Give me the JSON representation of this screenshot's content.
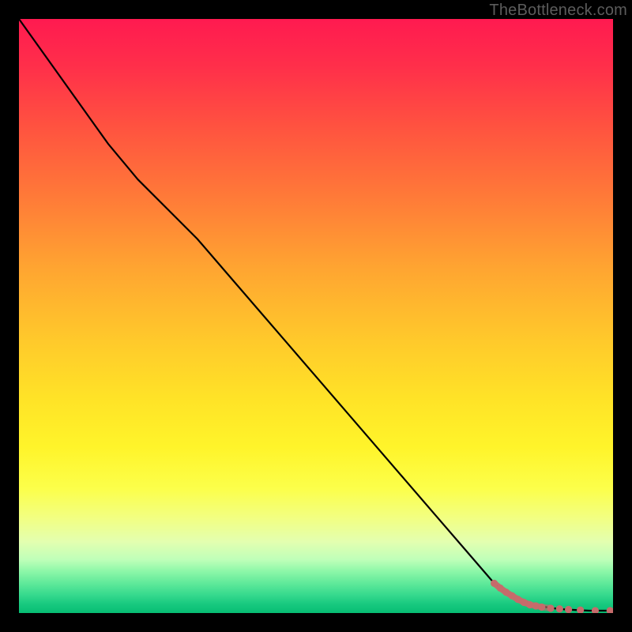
{
  "watermark": "TheBottleneck.com",
  "chart_data": {
    "type": "line",
    "title": "",
    "xlabel": "",
    "ylabel": "",
    "xlim": [
      0,
      100
    ],
    "ylim": [
      0,
      100
    ],
    "grid": false,
    "series": [
      {
        "name": "bottleneck-curve",
        "stroke": "#000000",
        "x": [
          0,
          5,
          10,
          15,
          20,
          25,
          30,
          35,
          40,
          45,
          50,
          55,
          60,
          65,
          70,
          75,
          80,
          82,
          84,
          86,
          88,
          90,
          92,
          94,
          96,
          98,
          100
        ],
        "y": [
          100,
          93,
          86,
          79,
          73,
          68,
          63,
          57.2,
          51.4,
          45.6,
          39.8,
          34.0,
          28.2,
          22.4,
          16.6,
          10.8,
          5.0,
          3.4,
          2.3,
          1.6,
          1.1,
          0.8,
          0.6,
          0.5,
          0.4,
          0.4,
          0.4
        ]
      }
    ],
    "tail_markers": {
      "name": "curve-tail-dots",
      "fill": "#c66b6b",
      "points": [
        {
          "x": 80.0,
          "y": 5.0
        },
        {
          "x": 81.0,
          "y": 4.2
        },
        {
          "x": 82.0,
          "y": 3.5
        },
        {
          "x": 83.0,
          "y": 2.9
        },
        {
          "x": 84.0,
          "y": 2.3
        },
        {
          "x": 85.0,
          "y": 1.8
        },
        {
          "x": 86.0,
          "y": 1.4
        },
        {
          "x": 87.0,
          "y": 1.2
        },
        {
          "x": 88.0,
          "y": 1.0
        },
        {
          "x": 89.5,
          "y": 0.8
        },
        {
          "x": 91.0,
          "y": 0.7
        },
        {
          "x": 92.5,
          "y": 0.6
        },
        {
          "x": 94.5,
          "y": 0.5
        },
        {
          "x": 97.0,
          "y": 0.4
        },
        {
          "x": 99.5,
          "y": 0.4
        }
      ]
    },
    "gradient_stops": [
      {
        "pos": 0,
        "color": "#ff1a50"
      },
      {
        "pos": 30,
        "color": "#ff7a38"
      },
      {
        "pos": 60,
        "color": "#ffe327"
      },
      {
        "pos": 85,
        "color": "#e3ffb0"
      },
      {
        "pos": 100,
        "color": "#07bd73"
      }
    ]
  }
}
